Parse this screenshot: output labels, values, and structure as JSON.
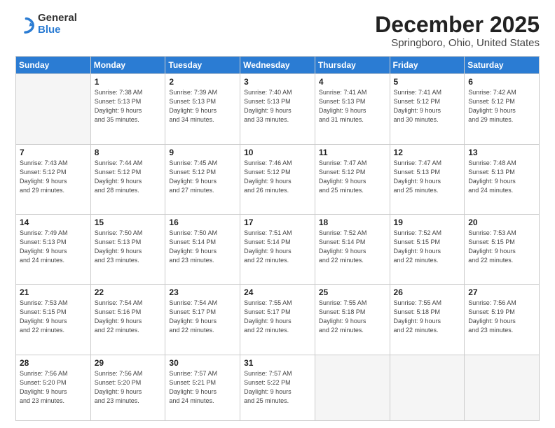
{
  "logo": {
    "line1": "General",
    "line2": "Blue"
  },
  "title": "December 2025",
  "subtitle": "Springboro, Ohio, United States",
  "header_days": [
    "Sunday",
    "Monday",
    "Tuesday",
    "Wednesday",
    "Thursday",
    "Friday",
    "Saturday"
  ],
  "weeks": [
    [
      {
        "day": "",
        "info": ""
      },
      {
        "day": "1",
        "info": "Sunrise: 7:38 AM\nSunset: 5:13 PM\nDaylight: 9 hours\nand 35 minutes."
      },
      {
        "day": "2",
        "info": "Sunrise: 7:39 AM\nSunset: 5:13 PM\nDaylight: 9 hours\nand 34 minutes."
      },
      {
        "day": "3",
        "info": "Sunrise: 7:40 AM\nSunset: 5:13 PM\nDaylight: 9 hours\nand 33 minutes."
      },
      {
        "day": "4",
        "info": "Sunrise: 7:41 AM\nSunset: 5:13 PM\nDaylight: 9 hours\nand 31 minutes."
      },
      {
        "day": "5",
        "info": "Sunrise: 7:41 AM\nSunset: 5:12 PM\nDaylight: 9 hours\nand 30 minutes."
      },
      {
        "day": "6",
        "info": "Sunrise: 7:42 AM\nSunset: 5:12 PM\nDaylight: 9 hours\nand 29 minutes."
      }
    ],
    [
      {
        "day": "7",
        "info": "Sunrise: 7:43 AM\nSunset: 5:12 PM\nDaylight: 9 hours\nand 29 minutes."
      },
      {
        "day": "8",
        "info": "Sunrise: 7:44 AM\nSunset: 5:12 PM\nDaylight: 9 hours\nand 28 minutes."
      },
      {
        "day": "9",
        "info": "Sunrise: 7:45 AM\nSunset: 5:12 PM\nDaylight: 9 hours\nand 27 minutes."
      },
      {
        "day": "10",
        "info": "Sunrise: 7:46 AM\nSunset: 5:12 PM\nDaylight: 9 hours\nand 26 minutes."
      },
      {
        "day": "11",
        "info": "Sunrise: 7:47 AM\nSunset: 5:12 PM\nDaylight: 9 hours\nand 25 minutes."
      },
      {
        "day": "12",
        "info": "Sunrise: 7:47 AM\nSunset: 5:13 PM\nDaylight: 9 hours\nand 25 minutes."
      },
      {
        "day": "13",
        "info": "Sunrise: 7:48 AM\nSunset: 5:13 PM\nDaylight: 9 hours\nand 24 minutes."
      }
    ],
    [
      {
        "day": "14",
        "info": "Sunrise: 7:49 AM\nSunset: 5:13 PM\nDaylight: 9 hours\nand 24 minutes."
      },
      {
        "day": "15",
        "info": "Sunrise: 7:50 AM\nSunset: 5:13 PM\nDaylight: 9 hours\nand 23 minutes."
      },
      {
        "day": "16",
        "info": "Sunrise: 7:50 AM\nSunset: 5:14 PM\nDaylight: 9 hours\nand 23 minutes."
      },
      {
        "day": "17",
        "info": "Sunrise: 7:51 AM\nSunset: 5:14 PM\nDaylight: 9 hours\nand 22 minutes."
      },
      {
        "day": "18",
        "info": "Sunrise: 7:52 AM\nSunset: 5:14 PM\nDaylight: 9 hours\nand 22 minutes."
      },
      {
        "day": "19",
        "info": "Sunrise: 7:52 AM\nSunset: 5:15 PM\nDaylight: 9 hours\nand 22 minutes."
      },
      {
        "day": "20",
        "info": "Sunrise: 7:53 AM\nSunset: 5:15 PM\nDaylight: 9 hours\nand 22 minutes."
      }
    ],
    [
      {
        "day": "21",
        "info": "Sunrise: 7:53 AM\nSunset: 5:15 PM\nDaylight: 9 hours\nand 22 minutes."
      },
      {
        "day": "22",
        "info": "Sunrise: 7:54 AM\nSunset: 5:16 PM\nDaylight: 9 hours\nand 22 minutes."
      },
      {
        "day": "23",
        "info": "Sunrise: 7:54 AM\nSunset: 5:17 PM\nDaylight: 9 hours\nand 22 minutes."
      },
      {
        "day": "24",
        "info": "Sunrise: 7:55 AM\nSunset: 5:17 PM\nDaylight: 9 hours\nand 22 minutes."
      },
      {
        "day": "25",
        "info": "Sunrise: 7:55 AM\nSunset: 5:18 PM\nDaylight: 9 hours\nand 22 minutes."
      },
      {
        "day": "26",
        "info": "Sunrise: 7:55 AM\nSunset: 5:18 PM\nDaylight: 9 hours\nand 22 minutes."
      },
      {
        "day": "27",
        "info": "Sunrise: 7:56 AM\nSunset: 5:19 PM\nDaylight: 9 hours\nand 23 minutes."
      }
    ],
    [
      {
        "day": "28",
        "info": "Sunrise: 7:56 AM\nSunset: 5:20 PM\nDaylight: 9 hours\nand 23 minutes."
      },
      {
        "day": "29",
        "info": "Sunrise: 7:56 AM\nSunset: 5:20 PM\nDaylight: 9 hours\nand 23 minutes."
      },
      {
        "day": "30",
        "info": "Sunrise: 7:57 AM\nSunset: 5:21 PM\nDaylight: 9 hours\nand 24 minutes."
      },
      {
        "day": "31",
        "info": "Sunrise: 7:57 AM\nSunset: 5:22 PM\nDaylight: 9 hours\nand 25 minutes."
      },
      {
        "day": "",
        "info": ""
      },
      {
        "day": "",
        "info": ""
      },
      {
        "day": "",
        "info": ""
      }
    ]
  ]
}
